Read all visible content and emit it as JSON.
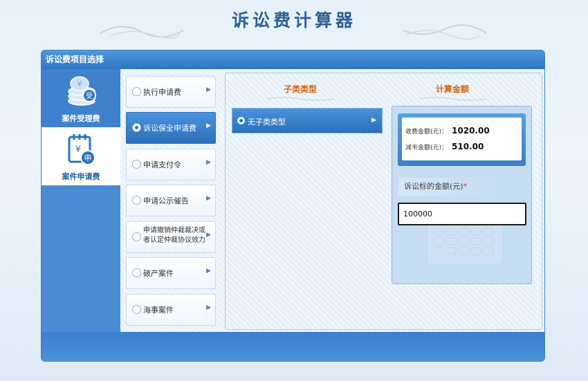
{
  "app": {
    "title": "诉讼费计算器"
  },
  "panel": {
    "header": "诉讼费项目选择"
  },
  "left_nav": [
    {
      "label": "案件受理费",
      "icon": "coin-stack-shou-icon",
      "selected": false
    },
    {
      "label": "案件申请费",
      "icon": "calendar-shen-icon",
      "selected": true
    }
  ],
  "fee_types": [
    {
      "label": "执行申请费",
      "selected": false
    },
    {
      "label": "诉讼保全申请费",
      "selected": true
    },
    {
      "label": "申请支付令",
      "selected": false
    },
    {
      "label": "申请公示催告",
      "selected": false
    },
    {
      "label": "申请撤销仲裁裁决或者认定仲裁协议效力",
      "selected": false
    },
    {
      "label": "破产案件",
      "selected": false
    },
    {
      "label": "海事案件",
      "selected": false
    }
  ],
  "columns": {
    "subtype_header": "子类类型",
    "calc_header": "计算金额"
  },
  "subtypes": [
    {
      "label": "无子类类型",
      "selected": true
    }
  ],
  "result": {
    "fee_label": "收费金额(元)：",
    "fee_value": "1020.00",
    "half_label": "减半金额(元)：",
    "half_value": "510.00"
  },
  "amount_input": {
    "label": "诉讼标的金额(元)",
    "required_mark": "*",
    "value": "100000"
  },
  "colors": {
    "accent": "#2b6fb9",
    "header_orange": "#d9630c",
    "title": "#2f5f95"
  }
}
